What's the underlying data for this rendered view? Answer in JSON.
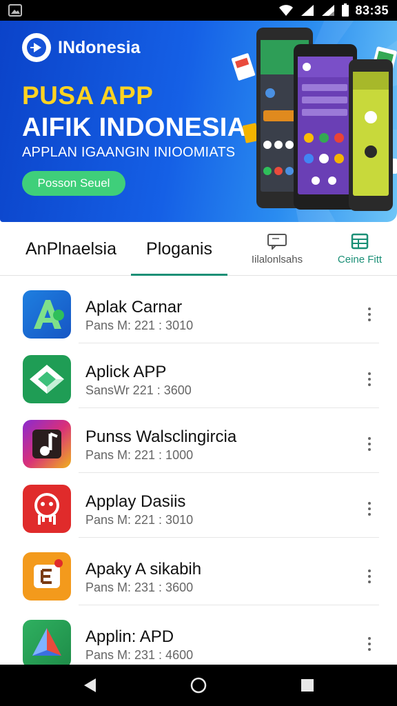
{
  "status_bar": {
    "time": "83:35"
  },
  "banner": {
    "brand_name": "INdonesia",
    "headline_1": "PUSA APP",
    "headline_2": "AIFIK INDONESIA",
    "subline": "APPLAN IGAANGIN INIOOMIATS",
    "button_label": "Posson Seuel"
  },
  "tabs": [
    {
      "label": "AnPlnaelsia"
    },
    {
      "label": "Ploganis"
    },
    {
      "label": "Iilalonlsahs",
      "icon": "chat-icon"
    },
    {
      "label": "Ceine Fitt",
      "icon": "grid-icon"
    }
  ],
  "apps": [
    {
      "title": "Aplak Carnar",
      "subtitle": "Pans M: 221 : 3010",
      "icon": "letter-a-icon",
      "color": "#1b72d8"
    },
    {
      "title": "Aplick APP",
      "subtitle": "SansWr 221 : 3600",
      "icon": "diamond-arrow-icon",
      "color": "#1f9d55"
    },
    {
      "title": "Punss Walsclingircia",
      "subtitle": "Pans M: 221 : 1000",
      "icon": "music-note-icon",
      "color": "#c0298a"
    },
    {
      "title": "Applay Dasiis",
      "subtitle": "Pans M: 221 : 3010",
      "icon": "face-icon",
      "color": "#e02b2b"
    },
    {
      "title": "Apaky A sikabih",
      "subtitle": "Pans M: 231 : 3600",
      "icon": "letter-e-icon",
      "color": "#f39a1c"
    },
    {
      "title": "Applin: APD",
      "subtitle": "Pans M: 231 : 4600",
      "icon": "prism-icon",
      "color": "#2aa058"
    }
  ]
}
